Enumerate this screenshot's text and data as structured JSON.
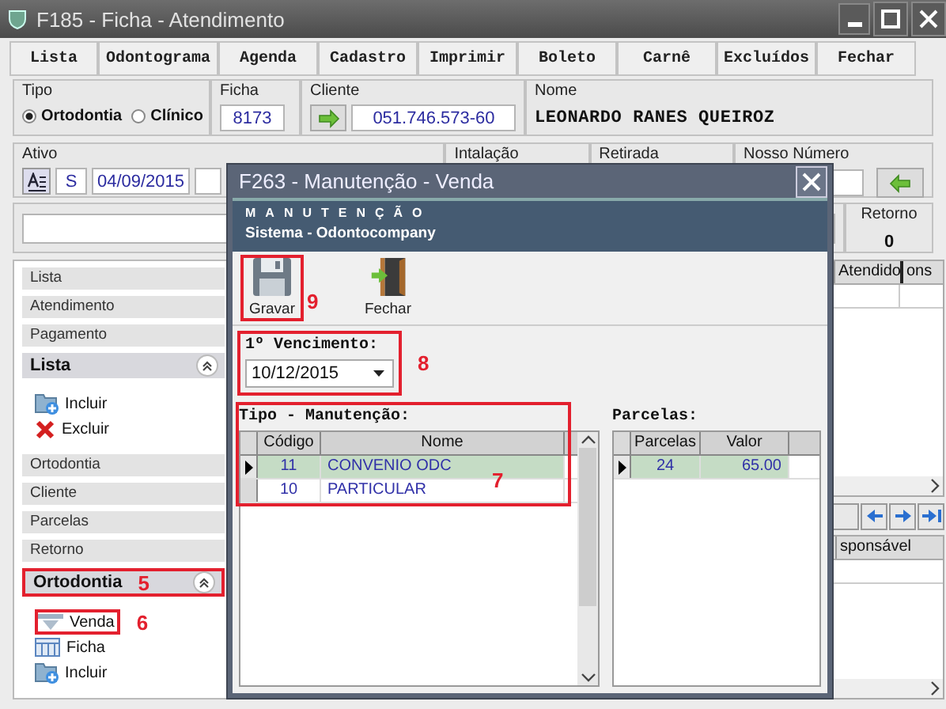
{
  "window": {
    "title": "F185 - Ficha - Atendimento"
  },
  "menu": [
    "Lista",
    "Odontograma",
    "Agenda",
    "Cadastro",
    "Imprimir",
    "Boleto",
    "Carnê",
    "Excluídos",
    "Fechar"
  ],
  "tipo": {
    "label": "Tipo",
    "options": [
      {
        "label": "Ortodontia",
        "selected": true
      },
      {
        "label": "Clínico",
        "selected": false
      }
    ]
  },
  "ficha": {
    "label": "Ficha",
    "value": "8173"
  },
  "cliente": {
    "label": "Cliente",
    "value": "051.746.573-60"
  },
  "nome": {
    "label": "Nome",
    "value": "LEONARDO RANES QUEIROZ"
  },
  "ativo": {
    "label": "Ativo",
    "flag": "S",
    "date": "04/09/2015"
  },
  "instalacao": {
    "label": "Intalação"
  },
  "retirada": {
    "label": "Retirada"
  },
  "nosso_numero": {
    "label": "Nosso Número"
  },
  "retorno": {
    "label": "Retorno",
    "value": "0"
  },
  "sidebar": [
    {
      "kind": "item",
      "label": "Lista"
    },
    {
      "kind": "item",
      "label": "Atendimento"
    },
    {
      "kind": "item",
      "label": "Pagamento"
    },
    {
      "kind": "group",
      "label": "Lista",
      "expanded": true,
      "children": [
        {
          "kind": "add",
          "label": "Incluir"
        },
        {
          "kind": "delete",
          "label": "Excluir"
        }
      ]
    },
    {
      "kind": "item",
      "label": "Ortodontia"
    },
    {
      "kind": "item",
      "label": "Cliente"
    },
    {
      "kind": "item",
      "label": "Parcelas"
    },
    {
      "kind": "item",
      "label": "Retorno"
    },
    {
      "kind": "group",
      "label": "Ortodontia",
      "expanded": true,
      "callout": "5",
      "children": [
        {
          "kind": "sell",
          "label": "Venda",
          "callout": "6"
        },
        {
          "kind": "sheet",
          "label": "Ficha"
        },
        {
          "kind": "add",
          "label": "Incluir"
        }
      ]
    }
  ],
  "table_1": {
    "columns": [
      "Atendido",
      "ons"
    ]
  },
  "table_2": {
    "columns": [
      "sponsável"
    ]
  },
  "dialog": {
    "title": "F263 - Manutenção - Venda",
    "heading": "MANUTENÇÃO",
    "subheading": "Sistema - Odontocompany",
    "toolbar": [
      {
        "kind": "save",
        "label": "Gravar",
        "callout": "9"
      },
      {
        "kind": "exit",
        "label": "Fechar"
      }
    ],
    "vencimento": {
      "label": "1º Vencimento:",
      "value": "10/12/2015",
      "callout": "8"
    },
    "tipo_manutencao": {
      "label": "Tipo - Manutenção:",
      "callout": "7",
      "columns": [
        "Código",
        "Nome"
      ],
      "rows": [
        {
          "cells": [
            "11",
            "CONVENIO ODC"
          ],
          "selected": true
        },
        {
          "cells": [
            "10",
            "PARTICULAR"
          ],
          "selected": false
        }
      ]
    },
    "parcelas": {
      "label": "Parcelas:",
      "columns": [
        "Parcelas",
        "Valor"
      ],
      "rows": [
        {
          "cells": [
            "24",
            "65.00"
          ],
          "selected": true
        }
      ]
    }
  }
}
